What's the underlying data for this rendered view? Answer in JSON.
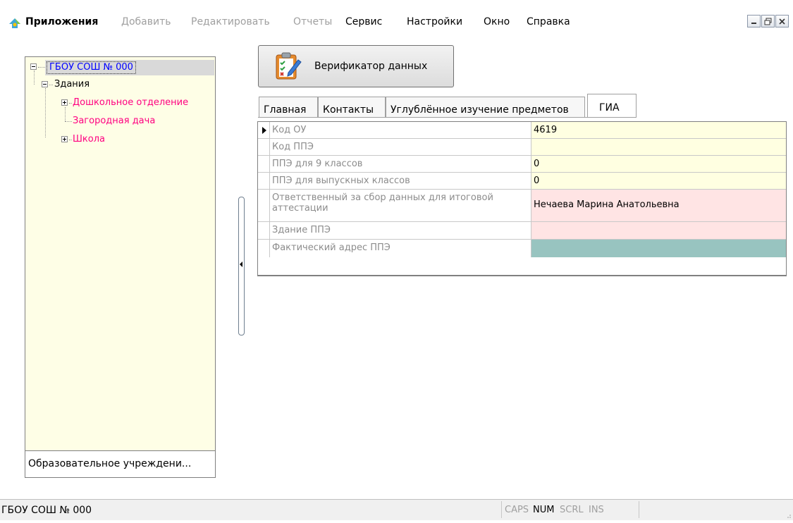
{
  "menu": {
    "items": [
      {
        "label": "Приложения",
        "enabled": true
      },
      {
        "label": "Добавить",
        "enabled": false
      },
      {
        "label": "Редактировать",
        "enabled": false
      },
      {
        "label": "Отчеты",
        "enabled": false
      },
      {
        "label": "Сервис",
        "enabled": true
      },
      {
        "label": "Настройки",
        "enabled": true
      },
      {
        "label": "Окно",
        "enabled": true
      },
      {
        "label": "Справка",
        "enabled": true
      }
    ]
  },
  "tree": {
    "root": "ГБОУ СОШ № 000",
    "buildings": "Здания",
    "children": [
      "Дошкольное отделение",
      "Загородная дача",
      "Школа"
    ]
  },
  "left_footer": "Образовательное учреждени...",
  "verify_button": "Верификатор данных",
  "tabs": [
    "Главная",
    "Контакты",
    "Углублённое изучение предметов",
    "ГИА"
  ],
  "grid": {
    "rows": [
      {
        "label": "Код ОУ",
        "value": "4619"
      },
      {
        "label": "Код ППЭ",
        "value": ""
      },
      {
        "label": "ППЭ для 9 классов",
        "value": "0"
      },
      {
        "label": "ППЭ для выпускных классов",
        "value": "0"
      },
      {
        "label": "Ответственный за сбор данных для итоговой аттестации",
        "value": "Нечаева  Марина  Анатольевна"
      },
      {
        "label": "Здание ППЭ",
        "value": ""
      },
      {
        "label": "Фактический адрес ППЭ",
        "value": ""
      }
    ]
  },
  "colors": {
    "value_yellow": "#ffffe1",
    "value_pink": "#ffe4e4",
    "value_teal": "#98c4c0",
    "tree_root": "#0000ff",
    "tree_child": "#ff0080"
  },
  "status": {
    "left": "ГБОУ СОШ № 000",
    "caps": "CAPS",
    "num": "NUM",
    "scrl": "SCRL",
    "ins": "INS"
  }
}
